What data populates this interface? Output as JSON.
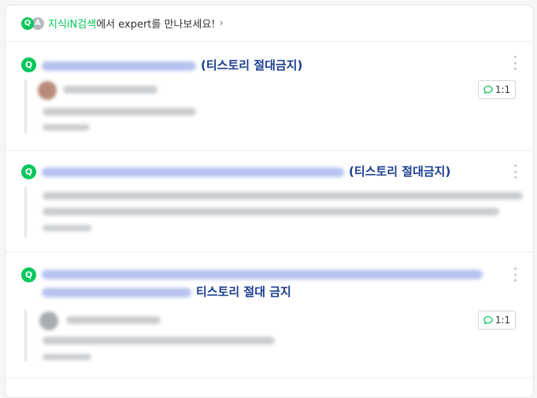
{
  "banner": {
    "badge_q": "Q",
    "badge_a": "A",
    "brand": "지식iN검색",
    "text": "에서 expert를 만나보세요!",
    "chevron": "›"
  },
  "items": [
    {
      "q_icon": "Q",
      "tag": "(티스토리 절대금지)",
      "chip": "1:1"
    },
    {
      "q_icon": "Q",
      "tag": "(티스토리 절대금지)"
    },
    {
      "q_icon": "Q",
      "tag": "티스토리 절대 금지",
      "chip": "1:1"
    }
  ],
  "icons": {
    "more": "more-vertical-icon",
    "chat": "speech-bubble-icon"
  },
  "colors": {
    "brand_green": "#03c75a",
    "tag_blue": "#1a3d8f"
  }
}
